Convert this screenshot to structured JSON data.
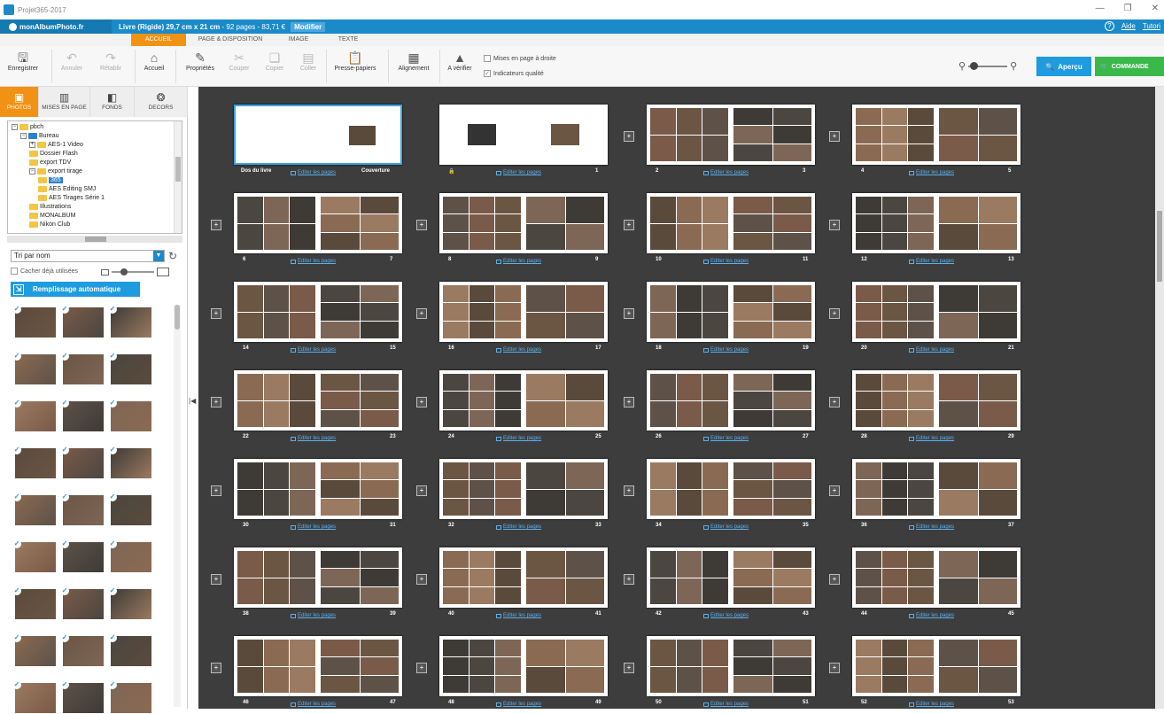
{
  "window": {
    "title": "Projet365-2017"
  },
  "brand": {
    "logo_text": "monAlbumPhoto.fr",
    "book_bold": "Livre (Rigide) 29,7 cm x 21 cm",
    "book_rest": " - 92 pages - 83,71 €",
    "modify": "Modifier",
    "help": "Aide",
    "tutorial": "Tutori"
  },
  "tabs": [
    "ACCUEIL",
    "PAGE & DISPOSITION",
    "IMAGE",
    "TEXTE"
  ],
  "ribbon": {
    "save": "Enregistrer",
    "undo": "Annuler",
    "redo": "Rétablir",
    "home": "Accueil",
    "props": "Propriétés",
    "cut": "Couper",
    "copy": "Copier",
    "paste": "Coller",
    "clipboard": "Presse-papiers",
    "align": "Alignement",
    "check": "A vérifier",
    "right_layout": "Mises en page à droite",
    "quality": "Indicateurs qualité",
    "apercu": "Aperçu",
    "commande": "COMMANDE"
  },
  "panel_tabs": [
    "PHOTOS",
    "MISES EN PAGE",
    "FONDS",
    "DECORS"
  ],
  "tree": [
    {
      "label": "pbch",
      "level": 1,
      "pm": "−"
    },
    {
      "label": "Bureau",
      "level": 2,
      "pm": "−",
      "blue": true
    },
    {
      "label": "AES-1 Video",
      "level": 3,
      "pm": "+"
    },
    {
      "label": "Dossier Flash",
      "level": 3
    },
    {
      "label": "export TDV",
      "level": 3
    },
    {
      "label": "export tirage",
      "level": 3,
      "pm": "−"
    },
    {
      "label": "365",
      "level": 4,
      "sel": true
    },
    {
      "label": "AES Editing SMJ",
      "level": 4
    },
    {
      "label": "AES Tirages Série 1",
      "level": 4
    },
    {
      "label": "Illustrations",
      "level": 3
    },
    {
      "label": "MONALBUM",
      "level": 3
    },
    {
      "label": "Nikon Club",
      "level": 3
    }
  ],
  "sort": {
    "value": "Tri par nom"
  },
  "hide_used": "Cacher déjà utilisées",
  "autofill": "Remplissage automatique",
  "edit_label": "Editer les pages",
  "cover": {
    "back": "Dos du livre",
    "front": "Couverture",
    "first": "1"
  },
  "spreads": [
    [
      "2",
      "3"
    ],
    [
      "4",
      "5"
    ],
    [
      "6",
      "7"
    ],
    [
      "8",
      "9"
    ],
    [
      "10",
      "11"
    ],
    [
      "12",
      "13"
    ],
    [
      "14",
      "15"
    ],
    [
      "16",
      "17"
    ],
    [
      "18",
      "19"
    ],
    [
      "20",
      "21"
    ],
    [
      "22",
      "23"
    ],
    [
      "24",
      "25"
    ],
    [
      "26",
      "27"
    ],
    [
      "28",
      "29"
    ],
    [
      "30",
      "31"
    ],
    [
      "32",
      "33"
    ],
    [
      "34",
      "35"
    ],
    [
      "36",
      "37"
    ],
    [
      "38",
      "39"
    ],
    [
      "40",
      "41"
    ],
    [
      "42",
      "43"
    ],
    [
      "44",
      "45"
    ],
    [
      "46",
      "47"
    ],
    [
      "48",
      "49"
    ],
    [
      "50",
      "51"
    ],
    [
      "52",
      "53"
    ]
  ],
  "colors": {
    "accent": "#f29214",
    "brand": "#1a8ac8",
    "workspace": "#3d3d3d",
    "order": "#3bb84a"
  }
}
